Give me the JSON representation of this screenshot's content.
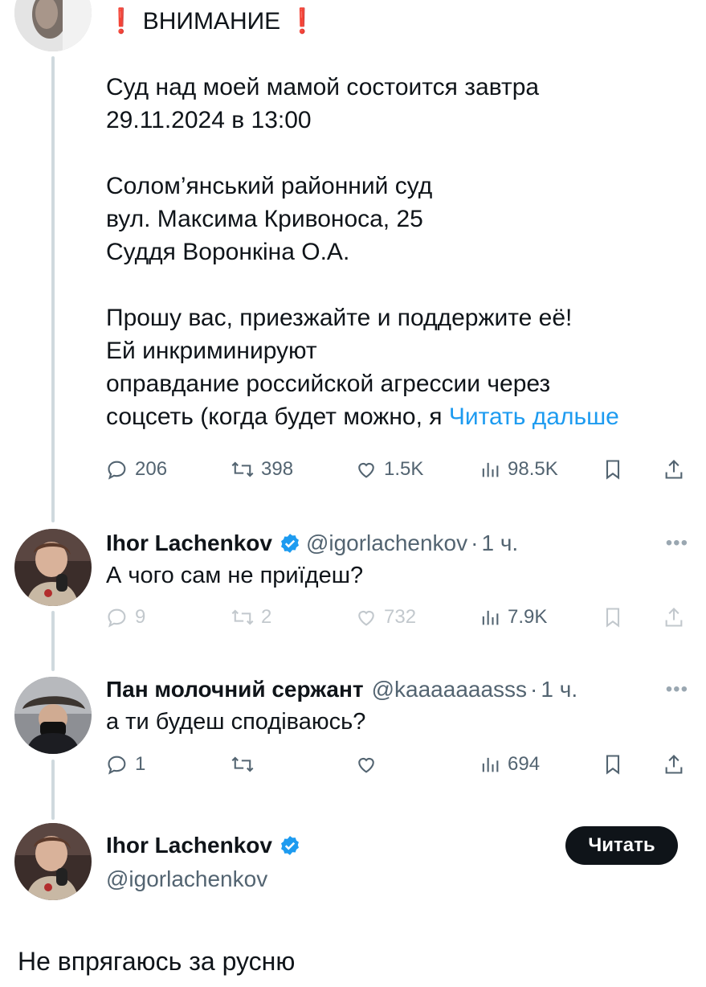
{
  "main_tweet": {
    "heading": "ВНИМАНИЕ",
    "lines": [
      "Суд над моей мамой состоится завтра",
      "29.11.2024 в 13:00",
      "",
      "Солом’янський районний суд",
      "вул. Максима Кривоноса, 25",
      "Суддя Воронкіна О.А.",
      "",
      "Прошу вас, приезжайте и поддержите её!",
      "Ей инкриминируют",
      "оправдание российской агрессии через"
    ],
    "last_line": "соцсеть (когда будет можно, я",
    "read_more": "Читать дальше",
    "stats": {
      "replies": "206",
      "retweets": "398",
      "likes": "1.5K",
      "views": "98.5K"
    }
  },
  "reply1": {
    "name": "Ihor Lachenkov",
    "handle": "@igorlachenkov",
    "time": "1 ч.",
    "text": "А чого сам не приїдеш?",
    "stats": {
      "replies": "9",
      "retweets": "2",
      "likes": "732",
      "views": "7.9K"
    }
  },
  "reply2": {
    "name": "Пан молочний сержант",
    "handle": "@kaaaaaaasss",
    "time": "1 ч.",
    "text": "а ти будеш сподіваюсь?",
    "stats": {
      "replies": "1",
      "views": "694"
    }
  },
  "focused_tweet": {
    "name": "Ihor Lachenkov",
    "handle": "@igorlachenkov",
    "follow_label": "Читать",
    "text": "Не впрягаюсь за русню"
  },
  "icons": {
    "reply": "reply-icon",
    "retweet": "retweet-icon",
    "like": "heart-icon",
    "views": "views-icon",
    "bookmark": "bookmark-icon",
    "share": "share-icon",
    "verified": "verified-badge-icon",
    "more": "more-icon"
  },
  "colors": {
    "accent": "#1d9bf0",
    "text": "#0f1419",
    "secondary": "#536471",
    "warning": "#f4212e",
    "thread_line": "#cfd9de"
  }
}
